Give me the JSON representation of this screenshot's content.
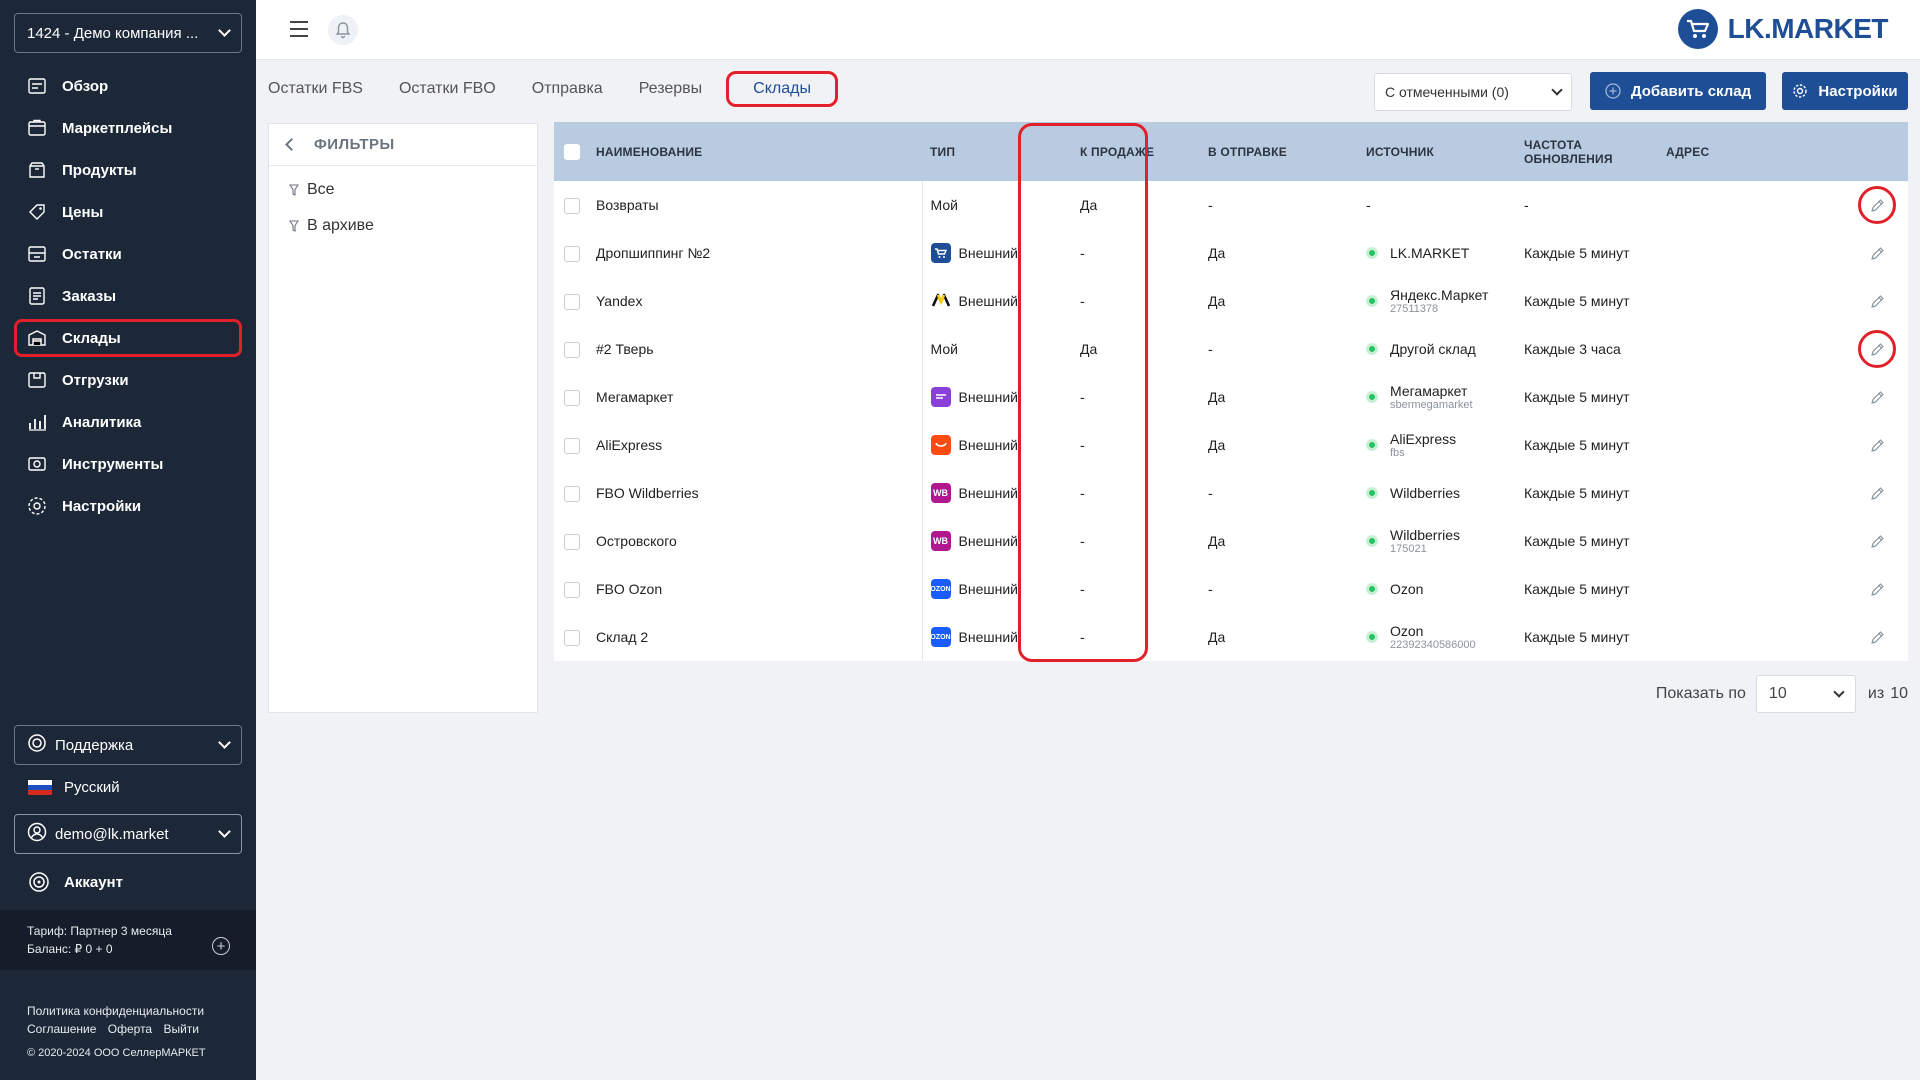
{
  "sidebar": {
    "company": "1424 - Демо компания ...",
    "nav": [
      {
        "label": "Обзор",
        "icon": "overview-icon"
      },
      {
        "label": "Маркетплейсы",
        "icon": "marketplaces-icon"
      },
      {
        "label": "Продукты",
        "icon": "products-icon"
      },
      {
        "label": "Цены",
        "icon": "prices-icon"
      },
      {
        "label": "Остатки",
        "icon": "stock-icon"
      },
      {
        "label": "Заказы",
        "icon": "orders-icon"
      },
      {
        "label": "Склады",
        "icon": "warehouse-icon",
        "active": true
      },
      {
        "label": "Отгрузки",
        "icon": "shipments-icon"
      },
      {
        "label": "Аналитика",
        "icon": "analytics-icon"
      },
      {
        "label": "Инструменты",
        "icon": "tools-icon"
      },
      {
        "label": "Настройки",
        "icon": "settings-icon"
      }
    ],
    "support": "Поддержка",
    "language": "Русский",
    "user": "demo@lk.market",
    "account": "Аккаунт",
    "tariff": "Тариф: Партнер 3 месяца",
    "balance": "Баланс: ₽ 0 + 0",
    "privacy": "Политика конфиденциальности",
    "agreement": "Соглашение",
    "offer": "Оферта",
    "logout": "Выйти",
    "copyright": "© 2020-2024 ООО СеллерМАРКЕТ"
  },
  "header": {
    "logo": "LK.MARKET"
  },
  "tabs": [
    {
      "label": "Остатки FBS"
    },
    {
      "label": "Остатки FBO"
    },
    {
      "label": "Отправка"
    },
    {
      "label": "Резервы"
    },
    {
      "label": "Склады",
      "active": true
    }
  ],
  "toolbar": {
    "bulk_select": "С отмеченными (0)",
    "add_warehouse": "Добавить склад",
    "settings": "Настройки"
  },
  "filters": {
    "title": "ФИЛЬТРЫ",
    "items": [
      "Все",
      "В архиве"
    ]
  },
  "table": {
    "headers": {
      "name": "НАИМЕНОВАНИЕ",
      "type": "ТИП",
      "for_sale": "К ПРОДАЖЕ",
      "in_shipping": "В ОТПРАВКЕ",
      "source": "ИСТОЧНИК",
      "frequency": "ЧАСТОТА ОБНОВЛЕНИЯ",
      "address": "АДРЕС"
    },
    "rows": [
      {
        "name": "Возвраты",
        "type": "Мой",
        "mp": "",
        "for_sale": "Да",
        "in_shipping": "-",
        "source": "-",
        "source_sub": "",
        "source_dot": false,
        "frequency": "-",
        "edit_highlight": true
      },
      {
        "name": "Дропшиппинг №2",
        "type": "Внешний",
        "mp": "lkmarket",
        "for_sale": "-",
        "in_shipping": "Да",
        "source": "LK.MARKET",
        "source_sub": "",
        "source_dot": true,
        "frequency": "Каждые 5 минут",
        "edit_highlight": false
      },
      {
        "name": "Yandex",
        "type": "Внешний",
        "mp": "yandex",
        "for_sale": "-",
        "in_shipping": "Да",
        "source": "Яндекс.Маркет",
        "source_sub": "27511378",
        "source_dot": true,
        "frequency": "Каждые 5 минут",
        "edit_highlight": false
      },
      {
        "name": "#2 Тверь",
        "type": "Мой",
        "mp": "",
        "for_sale": "Да",
        "in_shipping": "-",
        "source": "Другой склад",
        "source_sub": "",
        "source_dot": true,
        "frequency": "Каждые 3 часа",
        "edit_highlight": true
      },
      {
        "name": "Мегамаркет",
        "type": "Внешний",
        "mp": "megamarket",
        "for_sale": "-",
        "in_shipping": "Да",
        "source": "Мегамаркет",
        "source_sub": "sbermegamarket",
        "source_dot": true,
        "frequency": "Каждые 5 минут",
        "edit_highlight": false
      },
      {
        "name": "AliExpress",
        "type": "Внешний",
        "mp": "aliexpress",
        "for_sale": "-",
        "in_shipping": "Да",
        "source": "AliExpress",
        "source_sub": "fbs",
        "source_dot": true,
        "frequency": "Каждые 5 минут",
        "edit_highlight": false
      },
      {
        "name": "FBO Wildberries",
        "type": "Внешний",
        "mp": "wildberries",
        "for_sale": "-",
        "in_shipping": "-",
        "source": "Wildberries",
        "source_sub": "",
        "source_dot": true,
        "frequency": "Каждые 5 минут",
        "edit_highlight": false
      },
      {
        "name": "Островского",
        "type": "Внешний",
        "mp": "wildberries",
        "for_sale": "-",
        "in_shipping": "Да",
        "source": "Wildberries",
        "source_sub": "175021",
        "source_dot": true,
        "frequency": "Каждые 5 минут",
        "edit_highlight": false
      },
      {
        "name": "FBO Ozon",
        "type": "Внешний",
        "mp": "ozon",
        "for_sale": "-",
        "in_shipping": "-",
        "source": "Ozon",
        "source_sub": "",
        "source_dot": true,
        "frequency": "Каждые 5 минут",
        "edit_highlight": false
      },
      {
        "name": "Склад 2",
        "type": "Внешний",
        "mp": "ozon",
        "for_sale": "-",
        "in_shipping": "Да",
        "source": "Ozon",
        "source_sub": "22392340586000",
        "source_dot": true,
        "frequency": "Каждые 5 минут",
        "edit_highlight": false
      }
    ]
  },
  "marketplace_icons": {
    "lkmarket": {
      "bg": "#1e4e96",
      "glyph": ""
    },
    "yandex": {
      "bg": "#ffffff",
      "glyph": ""
    },
    "megamarket": {
      "bg": "#8b3fd9",
      "glyph": ""
    },
    "aliexpress": {
      "bg": "#ff4b12",
      "glyph": ""
    },
    "wildberries": {
      "bg": "#b1178f",
      "glyph": "WB"
    },
    "ozon": {
      "bg": "#1a5cff",
      "glyph": "OZON"
    }
  },
  "pagination": {
    "show_label": "Показать по",
    "per_page": "10",
    "of_label": "из",
    "total": "10"
  },
  "colors": {
    "sidebar_bg": "#1c2838",
    "accent": "#1e4e96",
    "highlight": "#e3202a",
    "table_header": "#b8cbe0",
    "status_green": "#22c55e"
  }
}
